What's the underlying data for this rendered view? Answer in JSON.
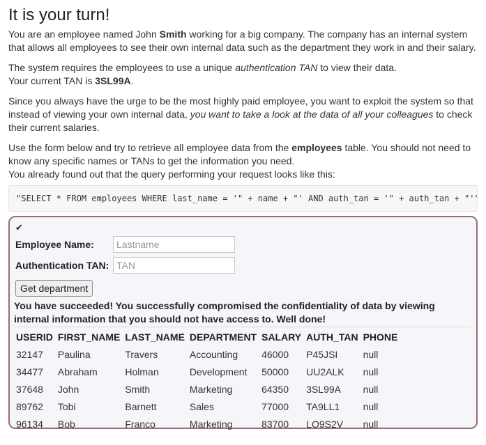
{
  "heading": "It is your turn!",
  "intro": {
    "before": "You are an employee named John ",
    "name_bold": "Smith",
    "after": " working for a big company. The company has an internal system that allows all employees to see their own internal data such as the department they work in and their salary."
  },
  "tan_para": {
    "before": "The system requires the employees to use a unique ",
    "em": "authentication TAN",
    "after": " to view their data.",
    "current_prefix": "Your current TAN is ",
    "current_tan": "3SL99A",
    "current_suffix": "."
  },
  "urge_para": {
    "before": "Since you always have the urge to be the most highly paid employee, you want to exploit the system so that instead of viewing your own internal data, ",
    "em": "you want to take a look at the data of all your colleagues",
    "after": " to check their current salaries."
  },
  "form_para": {
    "before": "Use the form below and try to retrieve all employee data from the ",
    "table_bold": "employees",
    "after": " table. You should not need to know any specific names or TANs to get the information you need.",
    "line2": "You already found out that the query performing your request looks like this:"
  },
  "query": "\"SELECT * FROM employees WHERE last_name = '\" + name + \"' AND auth_tan = '\" + auth_tan + \"'\";",
  "attack": {
    "check_icon": "check-icon",
    "check_glyph": "✔",
    "name_label": "Employee Name:",
    "name_placeholder": "Lastname",
    "name_value": "",
    "tan_label": "Authentication TAN:",
    "tan_placeholder": "TAN",
    "tan_value": "",
    "submit_label": "Get department",
    "feedback": "You have succeeded! You successfully compromised the confidentiality of data by viewing internal information that you should not have access to. Well done!",
    "border_color": "#9e6a74"
  },
  "results": {
    "columns": [
      "USERID",
      "FIRST_NAME",
      "LAST_NAME",
      "DEPARTMENT",
      "SALARY",
      "AUTH_TAN",
      "PHONE"
    ],
    "rows": [
      [
        "32147",
        "Paulina",
        "Travers",
        "Accounting",
        "46000",
        "P45JSI",
        "null"
      ],
      [
        "34477",
        "Abraham",
        "Holman",
        "Development",
        "50000",
        "UU2ALK",
        "null"
      ],
      [
        "37648",
        "John",
        "Smith",
        "Marketing",
        "64350",
        "3SL99A",
        "null"
      ],
      [
        "89762",
        "Tobi",
        "Barnett",
        "Sales",
        "77000",
        "TA9LL1",
        "null"
      ],
      [
        "96134",
        "Bob",
        "Franco",
        "Marketing",
        "83700",
        "LO9S2V",
        "null"
      ]
    ]
  }
}
